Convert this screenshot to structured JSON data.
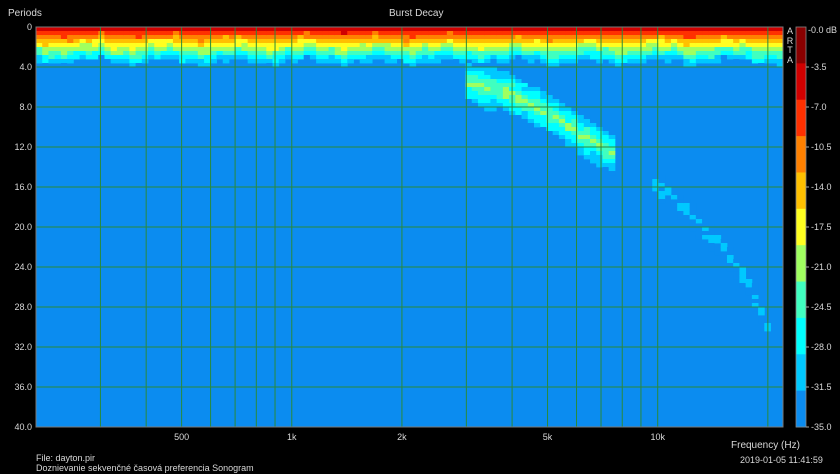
{
  "chart_data": {
    "type": "heatmap",
    "title": "Burst Decay",
    "ylabel": "Periods",
    "xlabel": "Frequency (Hz)",
    "y_ticks": [
      "0",
      "4.0",
      "8.0",
      "12.0",
      "16.0",
      "20.0",
      "24.0",
      "28.0",
      "32.0",
      "36.0",
      "40.0"
    ],
    "y_range": [
      0,
      40
    ],
    "x_scale": "log",
    "x_range": [
      200,
      22000
    ],
    "x_ticks": [
      {
        "value": 500,
        "label": "500"
      },
      {
        "value": 1000,
        "label": "1k"
      },
      {
        "value": 2000,
        "label": "2k"
      },
      {
        "value": 5000,
        "label": "5k"
      },
      {
        "value": 10000,
        "label": "10k"
      }
    ],
    "x_minor_gridlines": [
      300,
      400,
      600,
      700,
      800,
      900,
      3000,
      4000,
      6000,
      7000,
      8000,
      9000,
      20000
    ],
    "colorbar": {
      "unit_label": "-0.0 dB",
      "tick_labels": [
        "-3.5",
        "-7.0",
        "-10.5",
        "-14.0",
        "-17.5",
        "-21.0",
        "-24.5",
        "-28.0",
        "-31.5",
        "-35.0"
      ],
      "range_db": [
        -35,
        0
      ],
      "colors": [
        "#0b8cf0",
        "#00c8ff",
        "#00ffff",
        "#40ffc0",
        "#a0ff60",
        "#ffff20",
        "#ffc000",
        "#ff8000",
        "#ff3000",
        "#d00000",
        "#8a0000"
      ]
    },
    "brand": "ARTA",
    "grid": true,
    "background_level_db": -35,
    "features": [
      {
        "region": "early-decay ridge",
        "freq_range_hz": [
          200,
          22000
        ],
        "periods": [
          0,
          3.5
        ],
        "level_db": [
          0,
          -31.5
        ]
      },
      {
        "region": "resonance ridge 3k-8k",
        "freq_path_hz": [
          3000,
          4000,
          5000,
          6000,
          7500
        ],
        "period_path": [
          5.5,
          6.8,
          8.5,
          10.5,
          12.5
        ],
        "peak_db": -20
      },
      {
        "region": "resonance ridge 9k-20k",
        "freq_path_hz": [
          9500,
          12000,
          15000,
          18000,
          20000
        ],
        "period_path": [
          15,
          18.5,
          22,
          26,
          30
        ],
        "peak_db": -30
      }
    ]
  },
  "footer": {
    "file_line": "File: dayton.pir",
    "description_line": "Doznievanie sekvenčné časová preferencia Sonogram",
    "datetime": "2019-01-05  11:41:59"
  }
}
